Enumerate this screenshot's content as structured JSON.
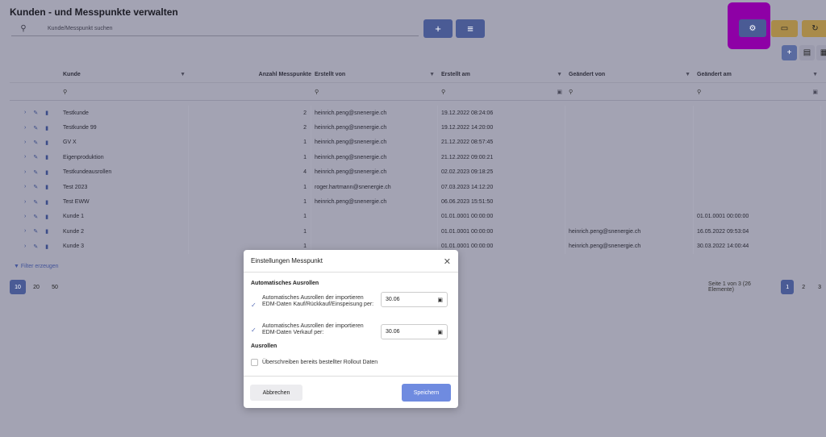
{
  "page": {
    "title": "Kunden - und Messpunkte verwalten"
  },
  "search": {
    "placeholder": "Kunde/Messpunkt suchen",
    "icon": "search-icon"
  },
  "toolbar": {
    "add": "+",
    "filter": "≡",
    "settings": "⚙",
    "book": "▭",
    "history": "↻",
    "grid_add": "+"
  },
  "columns": [
    "Kunde",
    "Anzahl Messpunkte",
    "Erstellt von",
    "Erstellt am",
    "Geändert von",
    "Geändert am"
  ],
  "rows": [
    {
      "kunde": "Testkunde",
      "anzahl": "2",
      "erstellt_von": "heinrich.peng@snenergie.ch",
      "erstellt_am": "19.12.2022 08:24:06",
      "geaendert_von": "",
      "geaendert_am": ""
    },
    {
      "kunde": "Testkunde 99",
      "anzahl": "2",
      "erstellt_von": "heinrich.peng@snenergie.ch",
      "erstellt_am": "19.12.2022 14:20:00",
      "geaendert_von": "",
      "geaendert_am": ""
    },
    {
      "kunde": "GV X",
      "anzahl": "1",
      "erstellt_von": "heinrich.peng@snenergie.ch",
      "erstellt_am": "21.12.2022 08:57:45",
      "geaendert_von": "",
      "geaendert_am": ""
    },
    {
      "kunde": "Eigenproduktion",
      "anzahl": "1",
      "erstellt_von": "heinrich.peng@snenergie.ch",
      "erstellt_am": "21.12.2022 09:00:21",
      "geaendert_von": "",
      "geaendert_am": ""
    },
    {
      "kunde": "Testkundeausrollen",
      "anzahl": "4",
      "erstellt_von": "heinrich.peng@snenergie.ch",
      "erstellt_am": "02.02.2023 09:18:25",
      "geaendert_von": "",
      "geaendert_am": ""
    },
    {
      "kunde": "Test 2023",
      "anzahl": "1",
      "erstellt_von": "roger.hartmann@snenergie.ch",
      "erstellt_am": "07.03.2023 14:12:20",
      "geaendert_von": "",
      "geaendert_am": ""
    },
    {
      "kunde": "Test EWW",
      "anzahl": "1",
      "erstellt_von": "heinrich.peng@snenergie.ch",
      "erstellt_am": "06.06.2023 15:51:50",
      "geaendert_von": "",
      "geaendert_am": ""
    },
    {
      "kunde": "Kunde 1",
      "anzahl": "1",
      "erstellt_von": "",
      "erstellt_am": "01.01.0001 00:00:00",
      "geaendert_von": "",
      "geaendert_am": "01.01.0001 00:00:00"
    },
    {
      "kunde": "Kunde 2",
      "anzahl": "1",
      "erstellt_von": "",
      "erstellt_am": "01.01.0001 00:00:00",
      "geaendert_von": "heinrich.peng@snenergie.ch",
      "geaendert_am": "16.05.2022 09:53:04"
    },
    {
      "kunde": "Kunde 3",
      "anzahl": "1",
      "erstellt_von": "",
      "erstellt_am": "01.01.0001 00:00:00",
      "geaendert_von": "heinrich.peng@snenergie.ch",
      "geaendert_am": "30.03.2022 14:00:44"
    }
  ],
  "filter_link": "Filter erzeugen",
  "page_sizes": [
    "10",
    "20",
    "50"
  ],
  "pagination": {
    "info": "Seite 1 von 3 (26 Elemente)",
    "pages": [
      "1",
      "2",
      "3"
    ]
  },
  "modal": {
    "title": "Einstellungen Messpunkt",
    "section1": "Automatisches Ausrollen",
    "option1_label": "Automatisches Ausrollen der importieren EDM-Daten Kauf/Rückkauf/Einspeisung per:",
    "option1_date": "30.06",
    "option2_label": "Automatisches Ausrollen der importieren EDM-Daten Verkauf per:",
    "option2_date": "30.06",
    "section2": "Ausrollen",
    "option3_label": "Überschreiben bereits bestellter Rollout Daten",
    "cancel": "Abbrechen",
    "save": "Speichern"
  }
}
